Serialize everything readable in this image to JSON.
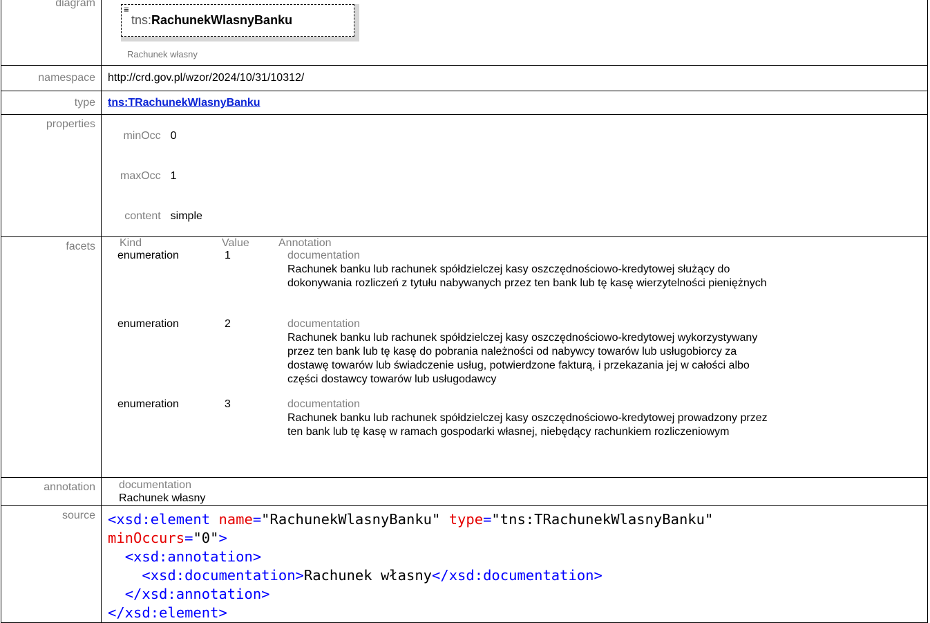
{
  "labels": {
    "diagram": "diagram",
    "namespace": "namespace",
    "type": "type",
    "properties": "properties",
    "facets": "facets",
    "annotation": "annotation",
    "source": "source"
  },
  "diagram": {
    "prefix": "tns:",
    "name": "RachunekWlasnyBanku",
    "caption": "Rachunek własny",
    "glyph": "≡"
  },
  "namespace": "http://crd.gov.pl/wzor/2024/10/31/10312/",
  "type": "tns:TRachunekWlasnyBanku",
  "properties": {
    "minOcc_label": "minOcc",
    "minOcc": "0",
    "maxOcc_label": "maxOcc",
    "maxOcc": "1",
    "content_label": "content",
    "content": "simple"
  },
  "facets": {
    "headers": {
      "kind": "Kind",
      "value": "Value",
      "annotation": "Annotation"
    },
    "rows": [
      {
        "kind": "enumeration",
        "value": "1",
        "doc_label": "documentation",
        "text": "Rachunek banku lub rachunek spółdzielczej kasy oszczędnościowo-kredytowej służący do dokonywania rozliczeń z tytułu nabywanych przez ten bank lub tę kasę wierzytelności pieniężnych"
      },
      {
        "kind": "enumeration",
        "value": "2",
        "doc_label": "documentation",
        "text": "Rachunek banku lub rachunek spółdzielczej kasy oszczędnościowo-kredytowej wykorzystywany przez ten bank lub tę kasę do pobrania należności od nabywcy towarów lub usługobiorcy za dostawę towarów lub świadczenie usług, potwierdzone fakturą, i przekazania jej w całości albo części dostawcy towarów lub usługodawcy"
      },
      {
        "kind": "enumeration",
        "value": "3",
        "doc_label": "documentation",
        "text": "Rachunek banku lub rachunek spółdzielczej kasy oszczędnościowo-kredytowej prowadzony przez ten bank lub tę kasę w ramach gospodarki własnej, niebędący rachunkiem rozliczeniowym"
      }
    ]
  },
  "annotation": {
    "label": "documentation",
    "text": "Rachunek własny"
  },
  "source": {
    "l1_open": "<",
    "l1_tag": "xsd:element",
    "l1_a1": "name",
    "l1_v1": "\"RachunekWlasnyBanku\"",
    "l1_a2": "type",
    "l1_v2": "\"tns:TRachunekWlasnyBanku\"",
    "l2_a3": "minOccurs",
    "l2_v3": "\"0\"",
    "l2_close": ">",
    "l3": "<xsd:annotation>",
    "l4_open": "<xsd:documentation>",
    "l4_text": "Rachunek własny",
    "l4_close": "</xsd:documentation>",
    "l5": "</xsd:annotation>",
    "l6": "</xsd:element>"
  }
}
